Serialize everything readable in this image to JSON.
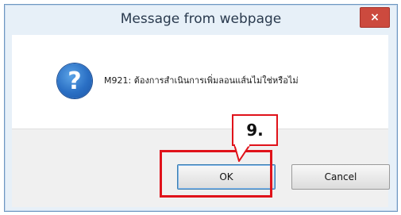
{
  "dialog": {
    "title": "Message from webpage",
    "close_label": "×",
    "message": "M921: ต้องการสำเนินการเพิ่มลอนแส์นไม่ใช่หรือไม่",
    "icon": "question-icon"
  },
  "buttons": {
    "ok": "OK",
    "cancel": "Cancel"
  },
  "annotation": {
    "step_label": "9.",
    "color": "#e0121a"
  }
}
